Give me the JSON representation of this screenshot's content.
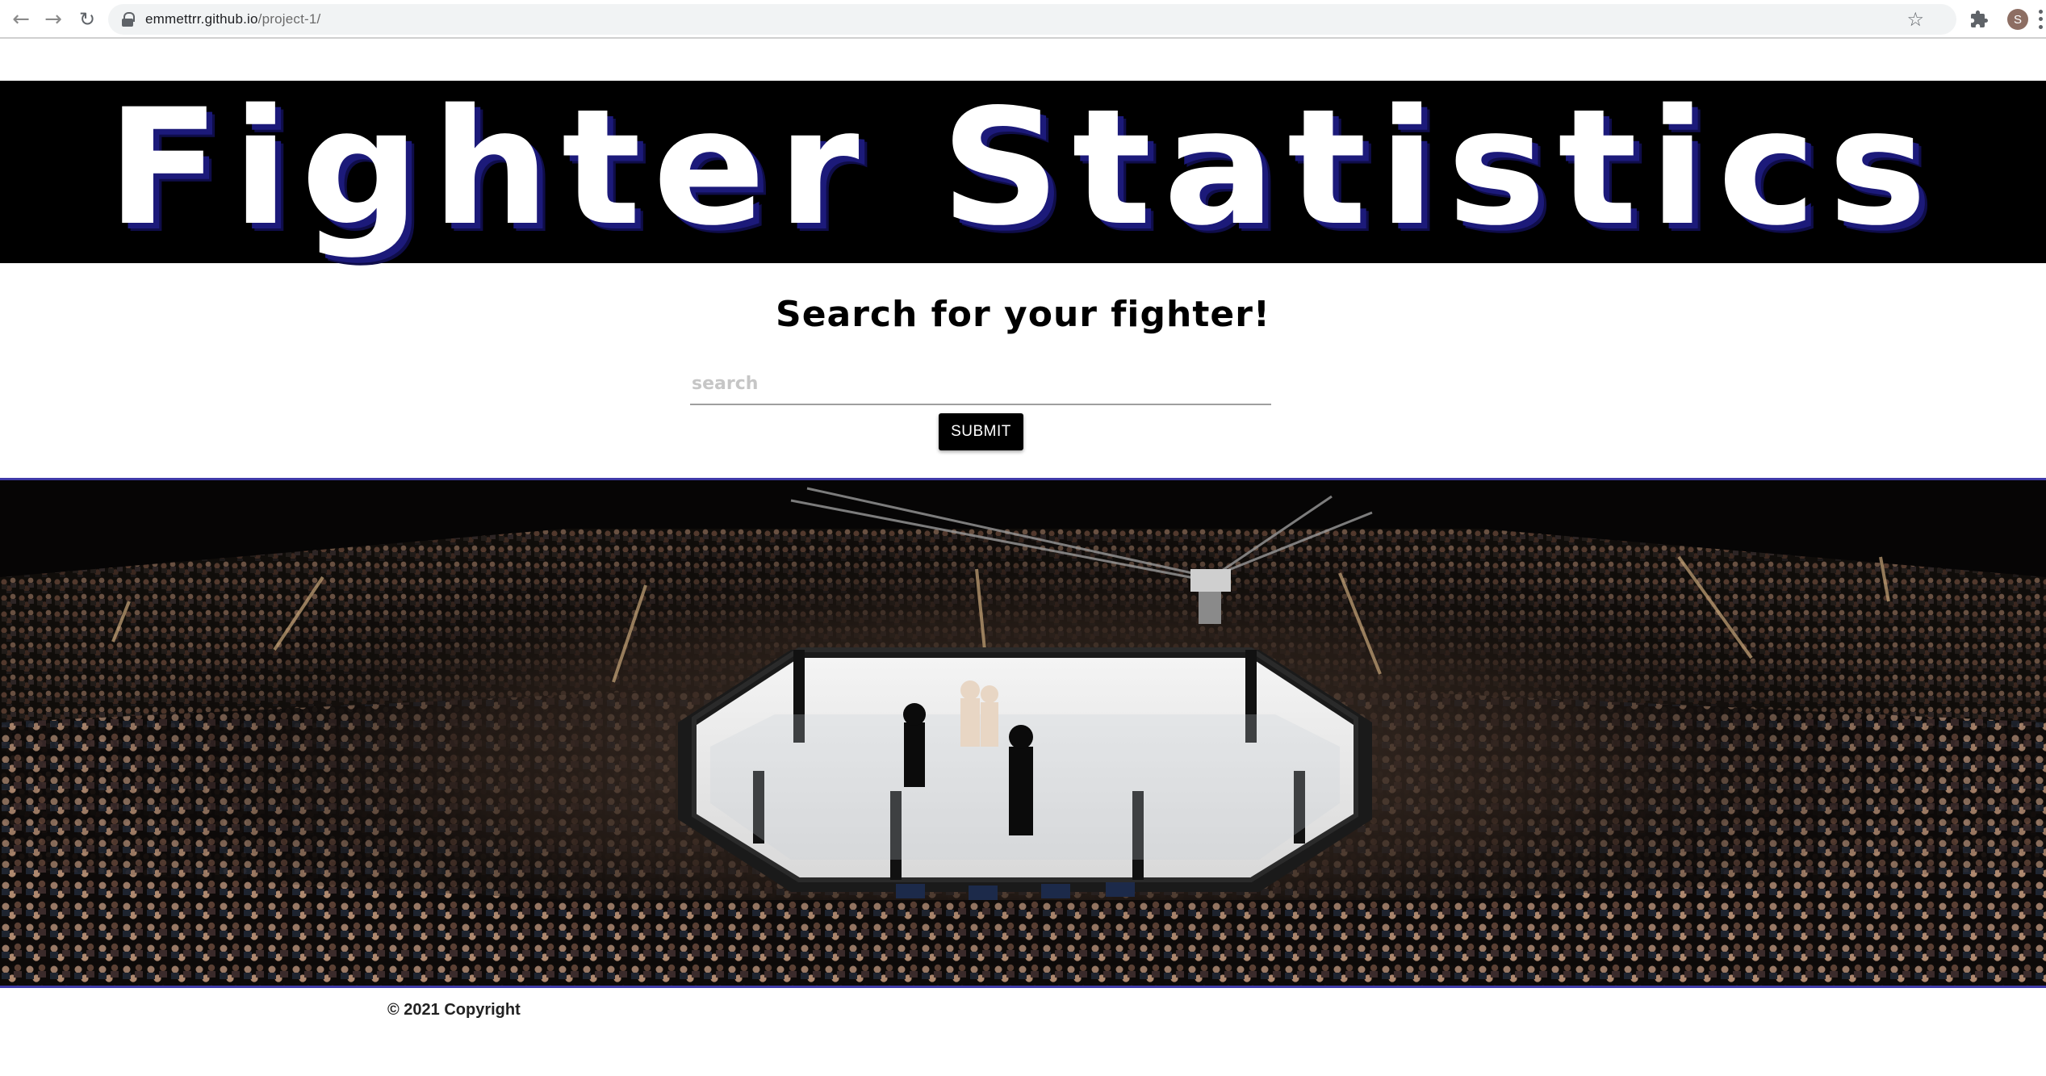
{
  "browser": {
    "url_host": "emmettrr.github.io",
    "url_path": "/project-1/",
    "profile_initial": "S",
    "icons": [
      "back-arrow-icon",
      "forward-arrow-icon",
      "reload-icon",
      "lock-icon",
      "star-icon",
      "extensions-icon",
      "menu-icon"
    ]
  },
  "header": {
    "title": "Fighter Statistics"
  },
  "search": {
    "heading": "Search for your fighter!",
    "placeholder": "search",
    "value": "",
    "submit_label": "SUBMIT"
  },
  "hero": {
    "subject": "octagon-cage-arena-photo"
  },
  "footer": {
    "copyright": "© 2021 Copyright"
  },
  "colors": {
    "banner_bg": "#000000",
    "title_text": "#ffffff",
    "title_shadow": "#1c1a7a",
    "button_bg": "#000000",
    "hero_border": "#3f3aa8"
  }
}
